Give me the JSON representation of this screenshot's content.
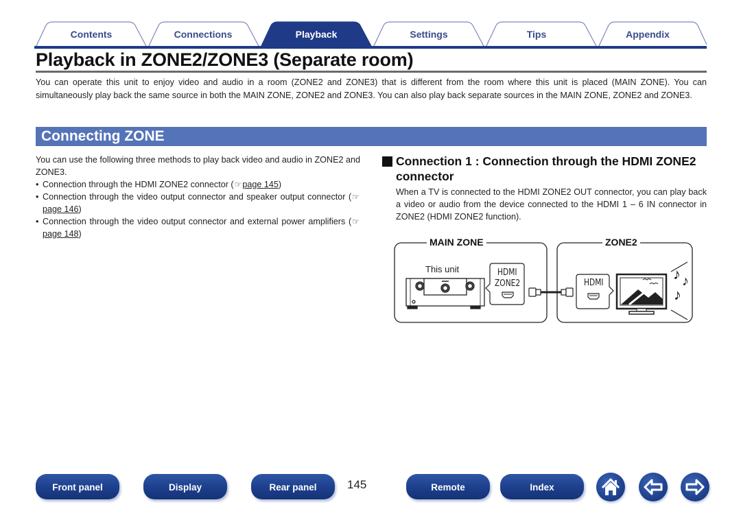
{
  "tabs": [
    {
      "label": "Contents",
      "active": false
    },
    {
      "label": "Connections",
      "active": false
    },
    {
      "label": "Playback",
      "active": true
    },
    {
      "label": "Settings",
      "active": false
    },
    {
      "label": "Tips",
      "active": false
    },
    {
      "label": "Appendix",
      "active": false
    }
  ],
  "title": "Playback in ZONE2/ZONE3 (Separate room)",
  "intro": "You can operate this unit to enjoy video and audio in a room (ZONE2 and ZONE3) that is different from the room where this unit is placed (MAIN ZONE). You can simultaneously play back the same source in both the MAIN ZONE, ZONE2 and ZONE3. You can also play back separate sources in the MAIN ZONE, ZONE2 and ZONE3.",
  "section": {
    "title": "Connecting ZONE",
    "lead": "You can use the following three methods to play back video and audio in ZONE2 and ZONE3.",
    "methods": [
      {
        "text": "Connection through the HDMI ZONE2 connector (",
        "ref": "page 145",
        "after": ")"
      },
      {
        "text": "Connection through the video output connector and speaker output connector (",
        "ref": "page 146",
        "after": ")"
      },
      {
        "text": "Connection through the video output connector and external power amplifiers (",
        "ref": "page 148",
        "after": ")"
      }
    ],
    "bullet": "•",
    "ref_icon": "☞"
  },
  "connection1": {
    "heading": "Connection 1 : Connection through the HDMI ZONE2 connector",
    "body": "When a TV is connected to the HDMI ZONE2 OUT connector, you can play back a video or audio from the device connected to the HDMI 1 – 6 IN connector in ZONE2 (HDMI ZONE2 function)."
  },
  "diagram": {
    "main_zone_label": "MAIN ZONE",
    "zone2_label": "ZONE2",
    "unit_label": "This unit",
    "out_port_line1": "HDMI",
    "out_port_line2": "ZONE2",
    "tv_port_label": "HDMI"
  },
  "bottom_nav": {
    "buttons": [
      "Front panel",
      "Display",
      "Rear panel",
      "Remote",
      "Index"
    ],
    "page_number": "145",
    "icons": [
      "home-icon",
      "arrow-left-icon",
      "arrow-right-icon"
    ]
  },
  "colors": {
    "tab_active": "#1f3a87",
    "tab_text": "#3b4a8a",
    "section_bar": "#5573b8",
    "nav_button": "#1d3f8b"
  }
}
